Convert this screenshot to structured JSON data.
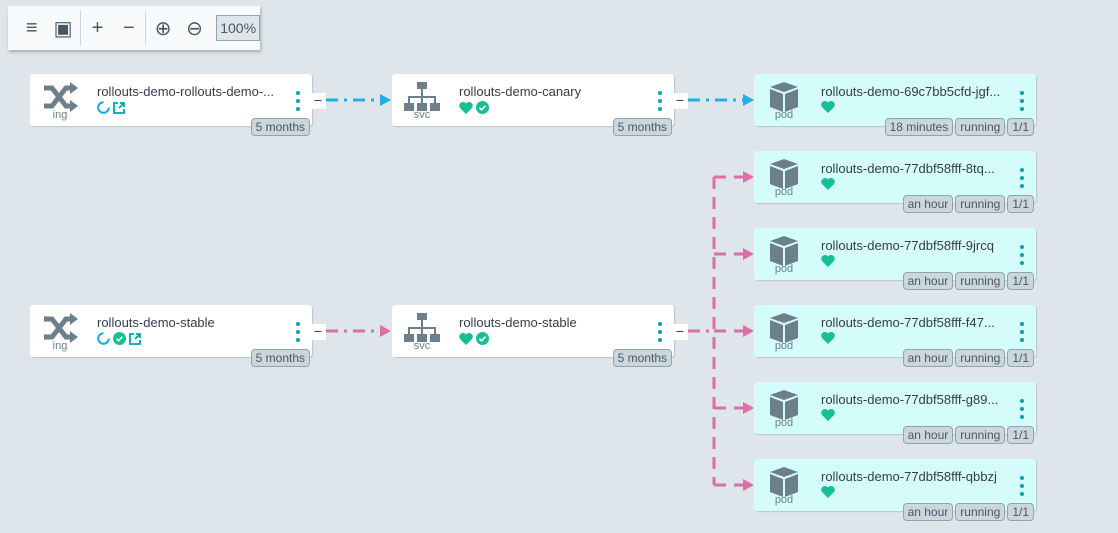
{
  "toolbar": {
    "items": [
      {
        "name": "list-view",
        "glyph": "≡"
      },
      {
        "name": "fit-view",
        "glyph": "▣"
      },
      {
        "name": "expand-all",
        "glyph": "+"
      },
      {
        "name": "collapse-all",
        "glyph": "−"
      },
      {
        "name": "zoom-in",
        "glyph": "⊕"
      },
      {
        "name": "zoom-out",
        "glyph": "⊖"
      }
    ],
    "zoom_level": "100%"
  },
  "colors": {
    "canary_edge": "#1fb0e4",
    "stable_edge": "#dd6fa8",
    "healthy": "#18be94",
    "progressing": "#0dadea",
    "link": "#00a2b3"
  },
  "nodes": {
    "ing1": {
      "kind": "ing",
      "title": "rollouts-demo-rollouts-demo-...",
      "tags": [
        "5 months"
      ]
    },
    "svc1": {
      "kind": "svc",
      "title": "rollouts-demo-canary",
      "tags": [
        "5 months"
      ]
    },
    "pod1": {
      "kind": "pod",
      "title": "rollouts-demo-69c7bb5cfd-jgf...",
      "tags": [
        "18 minutes",
        "running",
        "1/1"
      ]
    },
    "ing2": {
      "kind": "ing",
      "title": "rollouts-demo-stable",
      "tags": [
        "5 months"
      ]
    },
    "svc2": {
      "kind": "svc",
      "title": "rollouts-demo-stable",
      "tags": [
        "5 months"
      ]
    },
    "pod2": {
      "kind": "pod",
      "title": "rollouts-demo-77dbf58fff-8tq...",
      "tags": [
        "an hour",
        "running",
        "1/1"
      ]
    },
    "pod3": {
      "kind": "pod",
      "title": "rollouts-demo-77dbf58fff-9jrcq",
      "tags": [
        "an hour",
        "running",
        "1/1"
      ]
    },
    "pod4": {
      "kind": "pod",
      "title": "rollouts-demo-77dbf58fff-f47...",
      "tags": [
        "an hour",
        "running",
        "1/1"
      ]
    },
    "pod5": {
      "kind": "pod",
      "title": "rollouts-demo-77dbf58fff-g89...",
      "tags": [
        "an hour",
        "running",
        "1/1"
      ]
    },
    "pod6": {
      "kind": "pod",
      "title": "rollouts-demo-77dbf58fff-qbbzj",
      "tags": [
        "an hour",
        "running",
        "1/1"
      ]
    }
  },
  "collapse_glyph": "−"
}
